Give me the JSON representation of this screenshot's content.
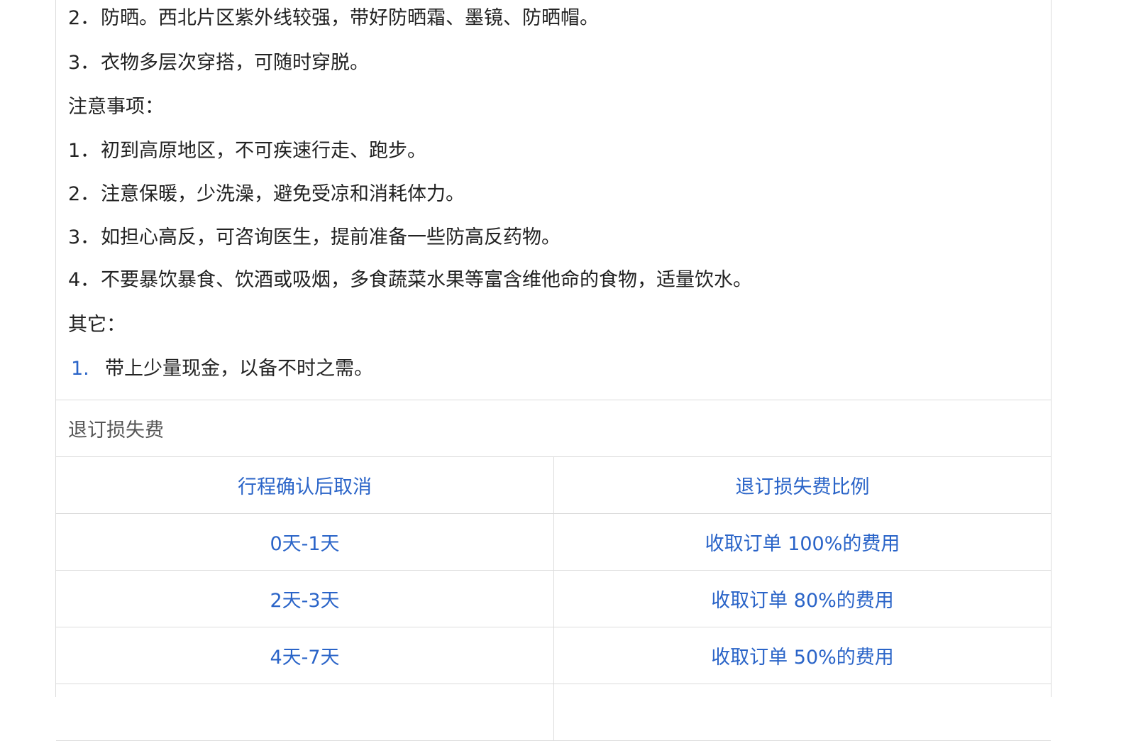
{
  "notes": {
    "tips_items": [
      {
        "num": "2．",
        "text": "防晒。西北片区紫外线较强，带好防晒霜、墨镜、防晒帽。"
      },
      {
        "num": "3．",
        "text": "衣物多层次穿搭，可随时穿脱。"
      }
    ],
    "cautions_heading": "注意事项：",
    "cautions_items": [
      {
        "num": "1．",
        "text": "初到高原地区，不可疾速行走、跑步。"
      },
      {
        "num": "2．",
        "text": "注意保暖，少洗澡，避免受凉和消耗体力。"
      },
      {
        "num": "3．",
        "text": "如担心高反，可咨询医生，提前准备一些防高反药物。"
      },
      {
        "num": "4．",
        "text": "不要暴饮暴食、饮酒或吸烟，多食蔬菜水果等富含维他命的食物，适量饮水。"
      }
    ],
    "other_heading": "其它：",
    "other_items": [
      {
        "num": "1.",
        "text": "带上少量现金，以备不时之需。"
      }
    ]
  },
  "refund": {
    "title": "退订损失费",
    "headers": [
      "行程确认后取消",
      "退订损失费比例"
    ],
    "rows": [
      [
        "0天-1天",
        "收取订单 100%的费用"
      ],
      [
        "2天-3天",
        "收取订单 80%的费用"
      ],
      [
        "4天-7天",
        "收取订单 50%的费用"
      ]
    ]
  },
  "colors": {
    "link_blue": "#2a64c8",
    "border": "#dcdcdc",
    "text": "#222222"
  }
}
